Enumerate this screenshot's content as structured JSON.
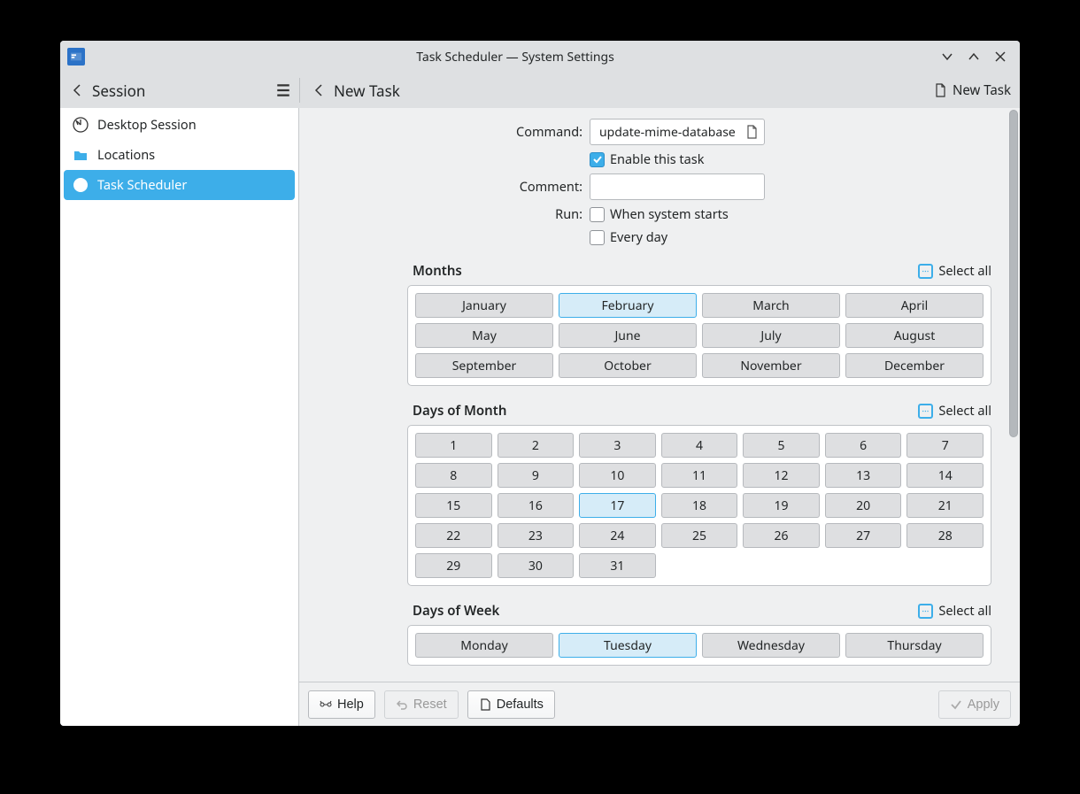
{
  "title": "Task Scheduler — System Settings",
  "subheader": {
    "session_label": "Session",
    "page_label": "New Task",
    "new_task_btn": "New Task"
  },
  "sidebar": {
    "items": [
      {
        "label": "Desktop Session",
        "icon": "desktop-session-icon"
      },
      {
        "label": "Locations",
        "icon": "folder-icon"
      },
      {
        "label": "Task Scheduler",
        "icon": "clock-icon",
        "active": true
      }
    ]
  },
  "form": {
    "command_label": "Command:",
    "command_value": "update-mime-database",
    "enable_label": "Enable this task",
    "enable_checked": true,
    "comment_label": "Comment:",
    "comment_value": "",
    "run_label": "Run:",
    "run_when_system_starts_label": "When system starts",
    "run_when_system_starts_checked": false,
    "run_every_day_label": "Every day",
    "run_every_day_checked": false
  },
  "sections": {
    "months": {
      "title": "Months",
      "select_all": "Select all",
      "items": [
        "January",
        "February",
        "March",
        "April",
        "May",
        "June",
        "July",
        "August",
        "September",
        "October",
        "November",
        "December"
      ],
      "selected": [
        "February"
      ]
    },
    "days_of_month": {
      "title": "Days of Month",
      "select_all": "Select all",
      "items": [
        "1",
        "2",
        "3",
        "4",
        "5",
        "6",
        "7",
        "8",
        "9",
        "10",
        "11",
        "12",
        "13",
        "14",
        "15",
        "16",
        "17",
        "18",
        "19",
        "20",
        "21",
        "22",
        "23",
        "24",
        "25",
        "26",
        "27",
        "28",
        "29",
        "30",
        "31"
      ],
      "selected": [
        "17"
      ]
    },
    "days_of_week": {
      "title": "Days of Week",
      "select_all": "Select all",
      "items": [
        "Monday",
        "Tuesday",
        "Wednesday",
        "Thursday"
      ],
      "selected": [
        "Tuesday"
      ]
    }
  },
  "footer": {
    "help": "Help",
    "reset": "Reset",
    "defaults": "Defaults",
    "apply": "Apply"
  }
}
